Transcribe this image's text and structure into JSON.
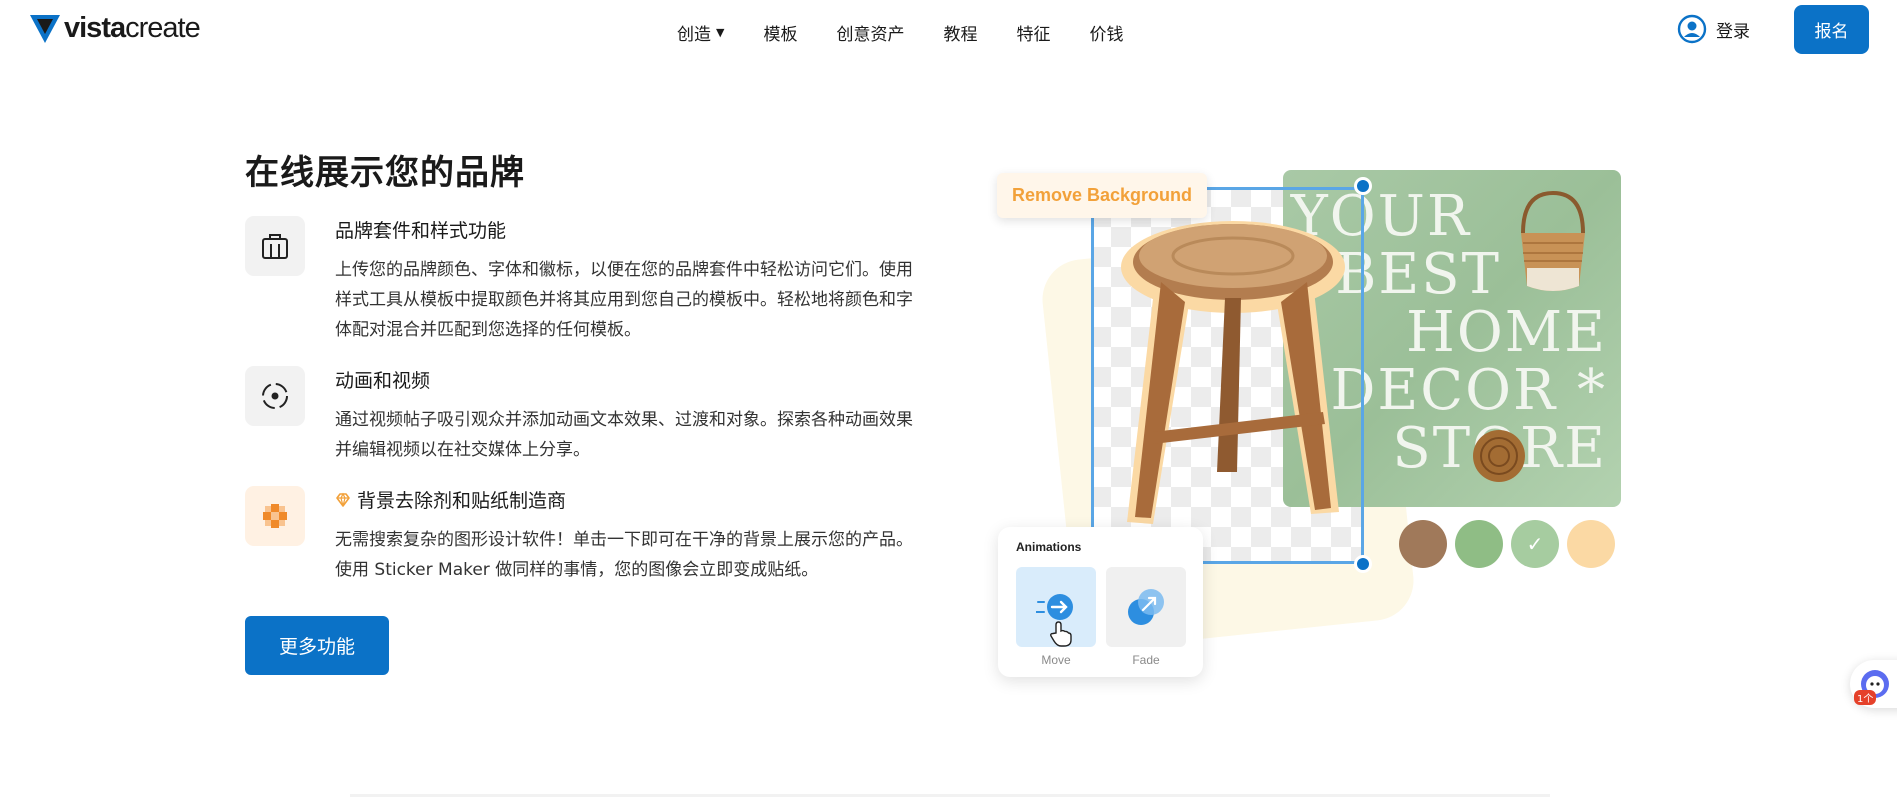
{
  "header": {
    "logo": {
      "brand_bold": "vista",
      "brand_light": "create",
      "icon": "vista-logo-icon"
    },
    "nav": [
      {
        "label": "创造",
        "has_dropdown": true
      },
      {
        "label": "模板"
      },
      {
        "label": "创意资产"
      },
      {
        "label": "教程"
      },
      {
        "label": "特征"
      },
      {
        "label": "价钱"
      }
    ],
    "login_label": "登录",
    "signup_label": "报名"
  },
  "main": {
    "headline": "在线展示您的品牌",
    "features": [
      {
        "icon": "briefcase-icon",
        "title": "品牌套件和样式功能",
        "lines": [
          "上传您的品牌颜色、字体和徽标，以便在您的品牌套件中轻松访问它们。使用",
          "样式工具从模板中提取颜色并将其应用到您自己的模板中。轻松地将颜色和字",
          "体配对混合并匹配到您选择的任何模板。"
        ]
      },
      {
        "icon": "animation-circle-icon",
        "title": "动画和视频",
        "lines": [
          "通过视频帖子吸引观众并添加动画文本效果、过渡和对象。探索各种动画效果",
          "并编辑视频以在社交媒体上分享。"
        ]
      },
      {
        "icon": "background-remover-icon",
        "title_icon": "diamond-icon",
        "title": "背景去除剂和贴纸制造商",
        "lines": [
          "无需搜索复杂的图形设计软件！单击一下即可在干净的背景上展示您的产品。",
          "使用 Sticker Maker 做同样的事情，您的图像会立即变成贴纸。"
        ]
      }
    ],
    "more_button": "更多功能"
  },
  "illustration": {
    "remove_bg_chip": "Remove Background",
    "poster_text": [
      "YOUR",
      "BEST",
      "HOME",
      "DECOR *",
      "STORE"
    ],
    "swatches": [
      "#a0795a",
      "#8fbd85",
      "#a6cca0",
      "#fbd9a4"
    ],
    "selected_swatch_check": "✓",
    "animations": {
      "title": "Animations",
      "options": [
        {
          "label": "Move"
        },
        {
          "label": "Fade"
        }
      ]
    },
    "chat_badge": "1个"
  },
  "colors": {
    "accent": "#0b72c7",
    "orange": "#f2a13a"
  }
}
